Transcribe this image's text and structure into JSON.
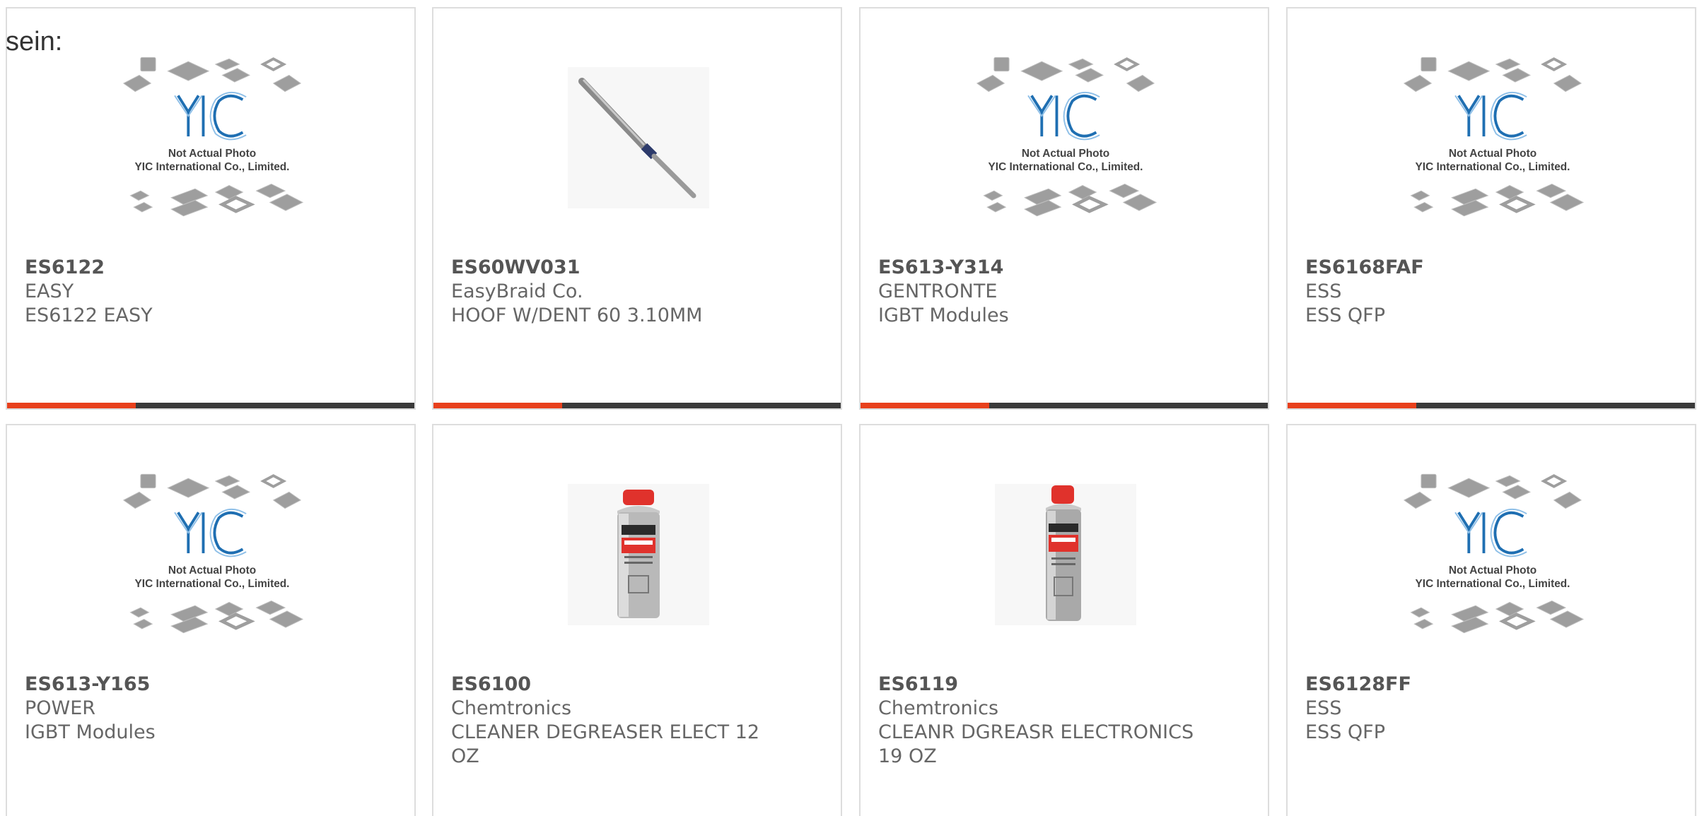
{
  "intro_text": "sein:",
  "placeholder": {
    "caption_line1": "Not Actual Photo",
    "caption_line2": "YIC International Co., Limited.",
    "logo_text": "YIC"
  },
  "products": [
    {
      "part_number": "ES6122",
      "brand": "EASY",
      "description": "ES6122 EASY",
      "image": "placeholder-logo"
    },
    {
      "part_number": "ES60WV031",
      "brand": "EasyBraid Co.",
      "description": "HOOF W/DENT 60 3.10MM",
      "image": "solder-tip-photo"
    },
    {
      "part_number": "ES613-Y314",
      "brand": "GENTRONTE",
      "description": "IGBT Modules",
      "image": "placeholder-logo"
    },
    {
      "part_number": "ES6168FAF",
      "brand": "ESS",
      "description": "ESS QFP",
      "image": "placeholder-logo"
    },
    {
      "part_number": "ES613-Y165",
      "brand": "POWER",
      "description": "IGBT Modules",
      "image": "placeholder-logo"
    },
    {
      "part_number": "ES6100",
      "brand": "Chemtronics",
      "description_lines": [
        "CLEANER DEGREASER ELECT 12",
        "OZ"
      ],
      "image": "spray-can-photo"
    },
    {
      "part_number": "ES6119",
      "brand": "Chemtronics",
      "description_lines": [
        "CLEANR DGREASR ELECTRONICS",
        "19 OZ"
      ],
      "image": "spray-can-photo"
    },
    {
      "part_number": "ES6128FF",
      "brand": "ESS",
      "description": "ESS QFP",
      "image": "placeholder-logo"
    }
  ],
  "colors": {
    "accent_bar": "#e8401c",
    "dark_bar": "#3a3a3a",
    "logo_blue": "#1f6fb2"
  }
}
